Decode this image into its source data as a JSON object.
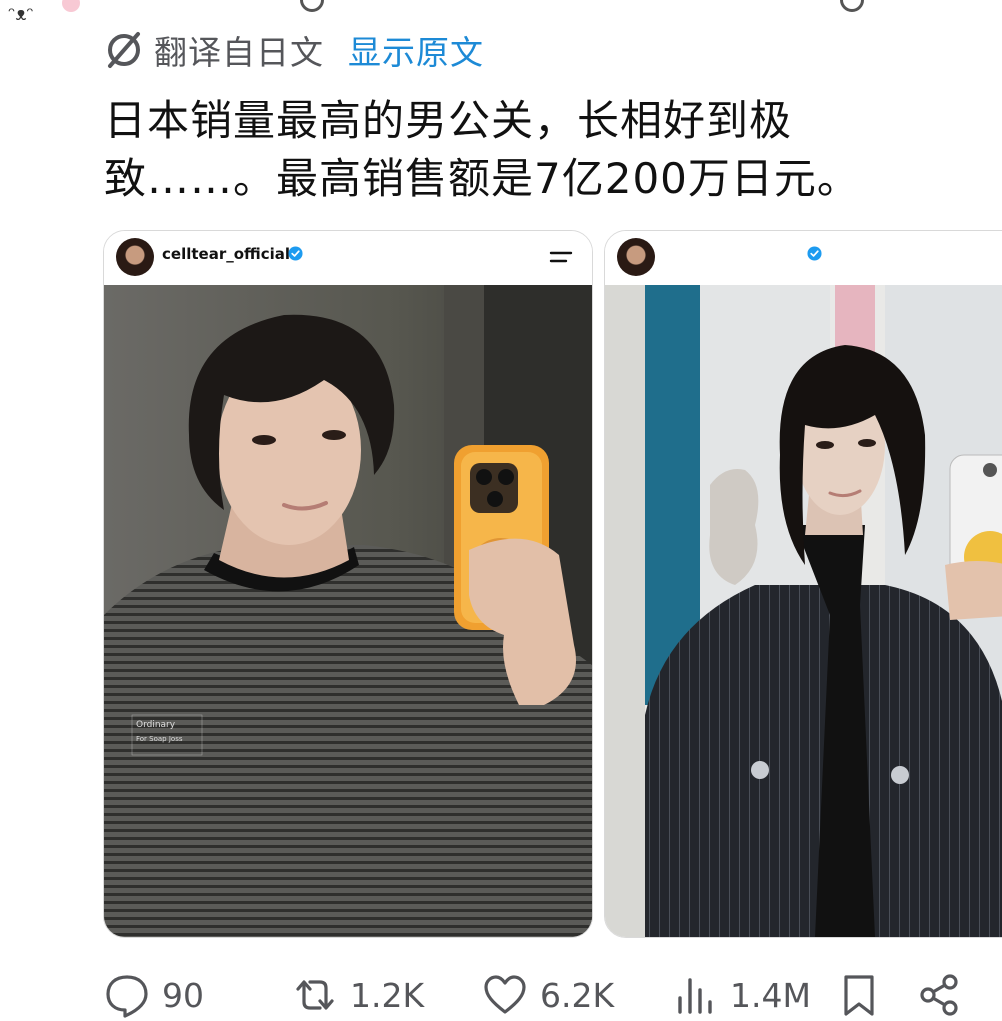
{
  "translate": {
    "label": "翻译自日文",
    "show_original": "显示原文"
  },
  "tweet": {
    "line1": "日本销量最高的男公关，长相好到极",
    "line2": "致……。最高销售额是7亿200万日元。"
  },
  "cards": [
    {
      "username": "celltear_official",
      "verified": true
    },
    {
      "username": "",
      "verified": true
    }
  ],
  "actions": {
    "replies": "90",
    "retweets": "1.2K",
    "likes": "6.2K",
    "views": "1.4M"
  },
  "icons": {
    "translate": "translate-icon",
    "reply": "speech-bubble-icon",
    "retweet": "retweet-icon",
    "like": "heart-icon",
    "views": "bar-chart-icon",
    "bookmark": "bookmark-icon",
    "share": "share-icon",
    "menu": "menu-icon",
    "verified": "verified-badge-icon"
  },
  "colors": {
    "link": "#1d8ad6",
    "muted": "#55565a",
    "verified": "#1d9bf0",
    "text": "#111111"
  }
}
